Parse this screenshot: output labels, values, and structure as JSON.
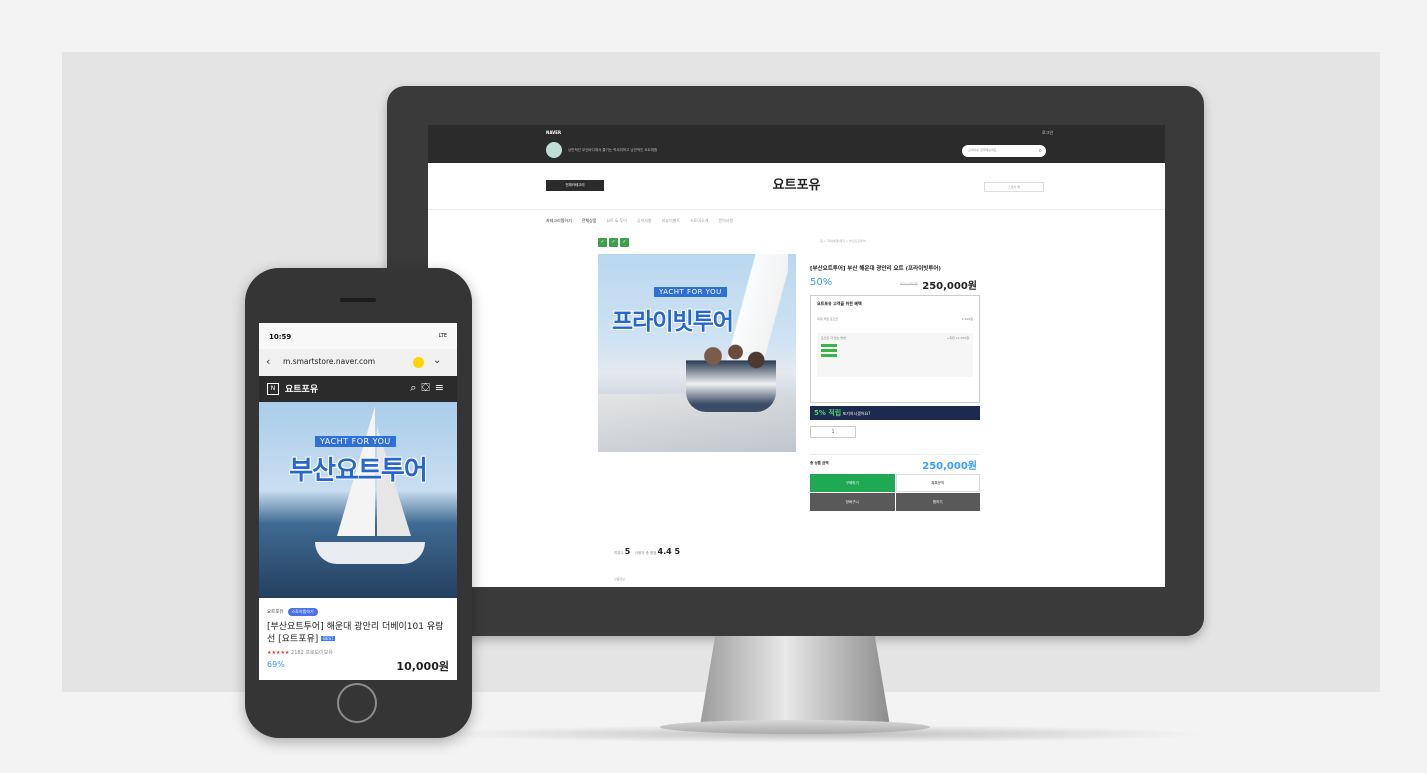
{
  "desktop": {
    "topbar": {
      "naver": "NAVER",
      "store_desc": "낭만적인 부산바다에서 즐기는 럭셔리하고 낭만적인 요트체험",
      "right": "로그인",
      "search_placeholder": "검색어를 입력해보세요"
    },
    "header": {
      "all_button": "전체카테고리",
      "logo": "요트포유",
      "right_button": "스토어 찜"
    },
    "nav": [
      "카테고리찜하기",
      "전체상품",
      "요트 & 투어",
      "공지사항",
      "리뷰이벤트",
      "스토어소개",
      "문의사항"
    ],
    "breadcrumb": "홈 > 국내여행/레저 > 부산요트투어",
    "product": {
      "image_tag": "YACHT FOR YOU",
      "image_title": "프라이빗투어",
      "title": "[부산요트투어] 부산 해운대 광안리 요트 (프라이빗투어)",
      "discount": "50%",
      "original_price": "500,000원",
      "price": "250,000원",
      "benefit_title": "요트포유 고객을 위한 혜택",
      "benefit_label": "최대 적립 포인트",
      "benefit_value": "2,498원",
      "benefit_box_label": "포인트 더 받는 방법",
      "benefit_box_value": "+최대 12,500원",
      "promo_text_a": "5% 적립",
      "promo_text_b": "포기하시겠어요?",
      "quantity": "1",
      "total_label": "총 상품 금액",
      "total_price": "250,000원",
      "buy_button": "구매하기",
      "talk_button": "톡톡문의",
      "cart_button": "장바구니",
      "wish_button": "찜하기",
      "rating_label": "리뷰수",
      "rating_value_a": "5",
      "rating_label_b": "사용자 총 평점",
      "rating_value_b": "4.4 5",
      "bottom_label": "상품정보"
    }
  },
  "mobile": {
    "time": "10:59",
    "signal": "LTE",
    "url": "m.smartstore.naver.com",
    "store_name": "요트포유",
    "hero_tag": "YACHT FOR YOU",
    "hero_title": "부산요트투어",
    "store_row": "요트포유",
    "store_tag": "스토어찜하기",
    "title": "[부산요트투어] 해운대 광안리 더베이101 유람선 [요트포유]",
    "best": "BEST",
    "stars": "★★★★★",
    "review": "2182 프로모이보유",
    "discount": "69%",
    "price": "10,000원"
  },
  "colors": {
    "accent": "#2566cf",
    "naver_green": "#1ea952",
    "price_blue": "#35a0ff"
  }
}
